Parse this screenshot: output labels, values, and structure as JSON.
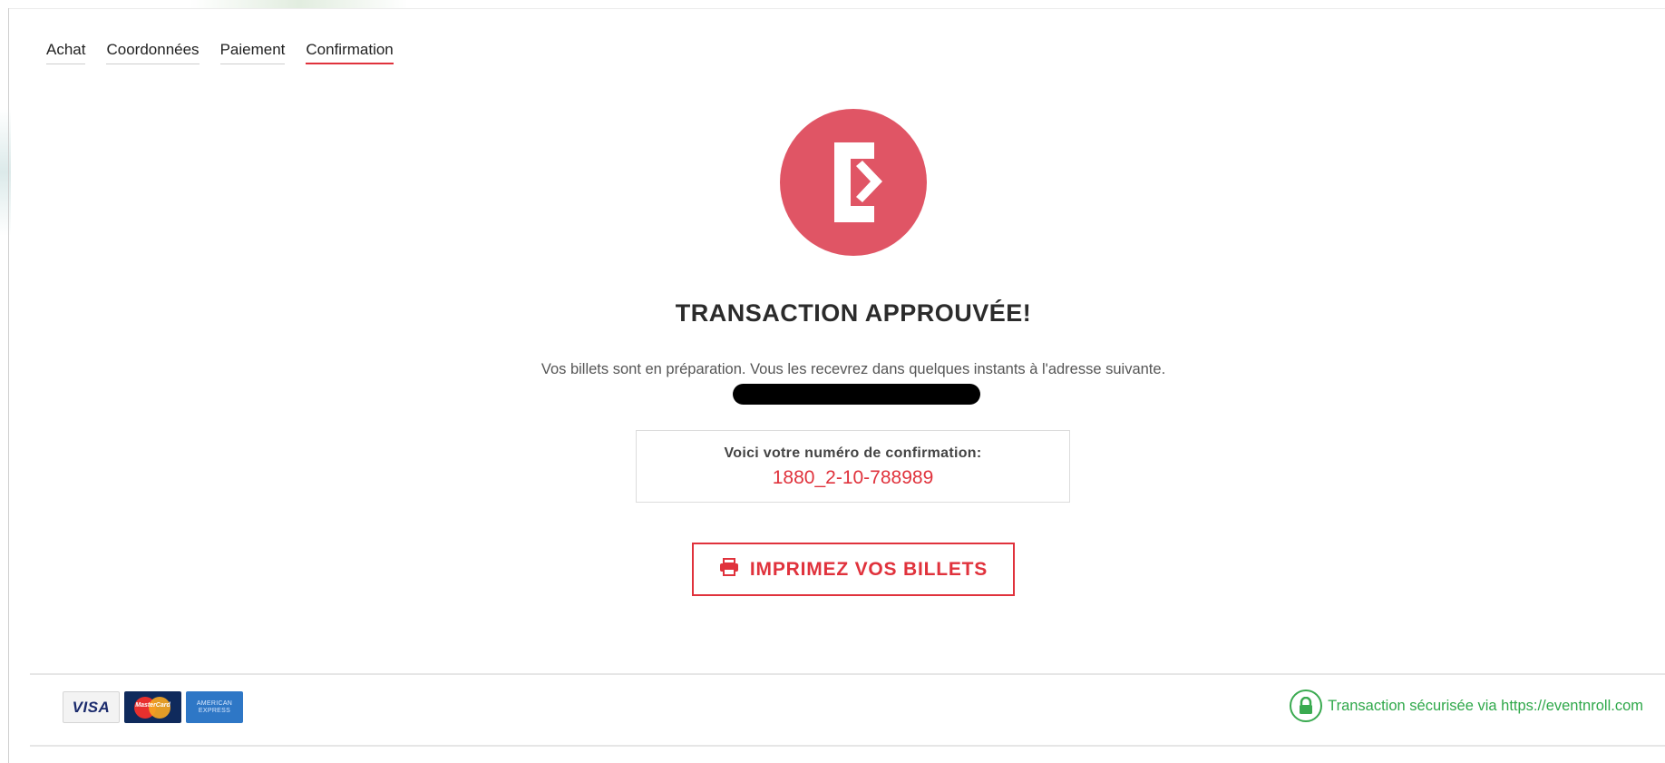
{
  "steps": [
    {
      "label": "Achat",
      "active": false
    },
    {
      "label": "Coordonnées",
      "active": false
    },
    {
      "label": "Paiement",
      "active": false
    },
    {
      "label": "Confirmation",
      "active": true
    }
  ],
  "logo": {
    "icon": "eventnroll-logo-icon",
    "color": "#e05565"
  },
  "confirmation": {
    "title": "TRANSACTION APPROUVÉE!",
    "message": "Vos billets sont en préparation. Vous les recevrez dans quelques instants à l'adresse suivante.",
    "number_label": "Voici votre numéro de confirmation:",
    "number": "1880_2-10-788989"
  },
  "print_button": {
    "label": "IMPRIMEZ VOS BILLETS",
    "icon": "printer-icon"
  },
  "footer": {
    "cards": [
      {
        "name": "visa",
        "text": "VISA"
      },
      {
        "name": "mastercard",
        "text": "MasterCard"
      },
      {
        "name": "american-express",
        "text_line1": "AMERICAN",
        "text_line2": "EXPRESS"
      }
    ],
    "secure_text": "Transaction sécurisée via https://eventnroll.com"
  },
  "colors": {
    "accent": "#e0323c",
    "logo": "#e05565",
    "secure": "#2fa84a"
  }
}
